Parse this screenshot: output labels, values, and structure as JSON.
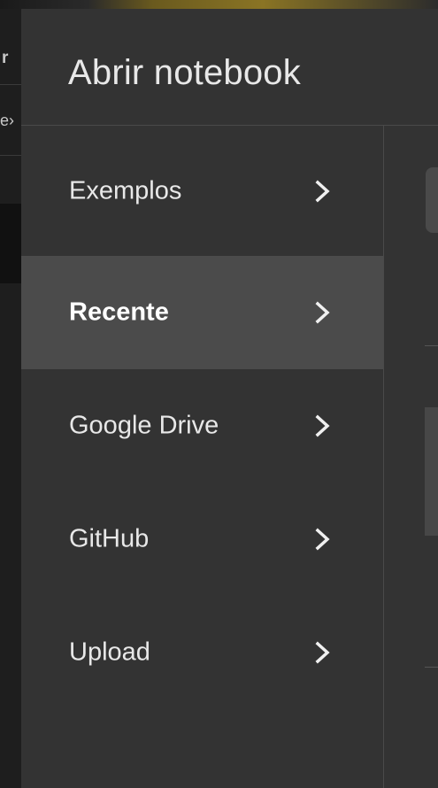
{
  "background": {
    "fragment_top": "r",
    "fragment_mid": "e›"
  },
  "dialog": {
    "title": "Abrir notebook"
  },
  "nav": {
    "items": [
      {
        "label": "Exemplos",
        "active": false
      },
      {
        "label": "Recente",
        "active": true
      },
      {
        "label": "Google Drive",
        "active": false
      },
      {
        "label": "GitHub",
        "active": false
      },
      {
        "label": "Upload",
        "active": false
      }
    ]
  },
  "colors": {
    "dialog_bg": "#333333",
    "active_item_bg": "#4b4b4b",
    "text": "#e8e8e8",
    "divider": "#4a4a4a"
  },
  "icons": {
    "chevron": "chevron-right-icon"
  }
}
